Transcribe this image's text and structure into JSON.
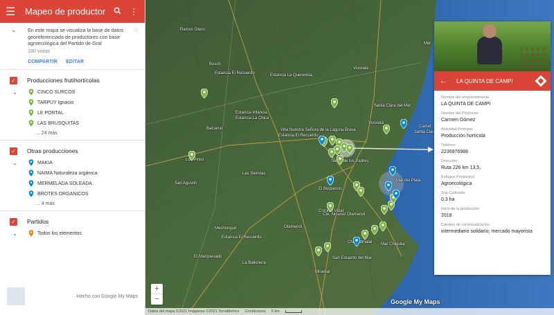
{
  "header": {
    "title": "Mapeo de productores ...",
    "menu_icon": "menu-icon",
    "search_icon": "search-icon",
    "more_icon": "more-vert-icon"
  },
  "description": {
    "text": "En este mapa se visualiza la base de datos georeferenciada de productores con base agroecológica del Partido de Gral",
    "views": "180 vistas",
    "share_label": "COMPARTIR",
    "edit_label": "EDITAR"
  },
  "layers": [
    {
      "title": "Producciones frutihortícolas",
      "pin_color": "#7cb342",
      "items": [
        "CINCO SURCOS",
        "TARPUY Ignacio",
        "LE PORTAL",
        "LAS BRUSQUITAS"
      ],
      "more": "... 24 más"
    },
    {
      "title": "Otras producciones",
      "pin_color": "#0288d1",
      "items": [
        "MAKIA",
        "NAIMA Naturaleza orgánica",
        "MERMELADA SOLEADA",
        "BROTES ORGANICOS"
      ],
      "more": "... 4 más"
    },
    {
      "title": "Partidos",
      "pin_color": "#f57c00",
      "items": [
        "Todos los elementos"
      ],
      "more": ""
    }
  ],
  "footer": {
    "made_with": "Hecho con Google My Maps"
  },
  "map": {
    "labels": [
      {
        "text": "Ramos Otero"
      },
      {
        "text": "Bosch"
      },
      {
        "text": "Estancia El Recuerdo"
      },
      {
        "text": "Estancia La Querencia"
      },
      {
        "text": "Vivorata"
      },
      {
        "text": "Mar"
      },
      {
        "text": "Estancia Infancia"
      },
      {
        "text": "Estancia La Chica"
      },
      {
        "text": "Villa Nuestra Señora de la Laguna Brava"
      },
      {
        "text": "Estancia El Recuerdo"
      },
      {
        "text": "Balcarce"
      },
      {
        "text": "Los Pinos"
      },
      {
        "text": "Las Sierritas"
      },
      {
        "text": "San Agustín"
      },
      {
        "text": "El Boqueron"
      },
      {
        "text": "Mechongué"
      },
      {
        "text": "Otamendi"
      },
      {
        "text": "Coronel Vidal"
      },
      {
        "text": "Estancia El Recuerdo"
      },
      {
        "text": "Santa Clara del Mar"
      },
      {
        "text": "Sierra de los Padres"
      },
      {
        "text": "Mar del Plata"
      },
      {
        "text": "Cte. Nicanor Otamendi"
      },
      {
        "text": "Chapadmalal"
      },
      {
        "text": "San Eduardo del Mar"
      },
      {
        "text": "Miramar"
      },
      {
        "text": "La Ballenera"
      },
      {
        "text": "El Marquesado"
      },
      {
        "text": "Vivoratá"
      },
      {
        "text": "Camet"
      },
      {
        "text": "Santa Clara del Mar"
      },
      {
        "text": "Mar Chiquita"
      }
    ],
    "zoom_in": "+",
    "zoom_out": "−",
    "brand": "Google My Maps",
    "attribution": "Datos del mapa ©2021 Imágenes ©2021 TerraMetrics",
    "conditions": "Condiciones",
    "scale": "5 km"
  },
  "panel": {
    "title": "LA QUINTA DE CAMPI",
    "fields": [
      {
        "label": "Nombre del emprendimiento",
        "value": "LA QUINTA DE CAMPI"
      },
      {
        "label": "Nombre del Productor",
        "value": "Carmen Gómez"
      },
      {
        "label": "Actividad Principal",
        "value": "Producción hortícola"
      },
      {
        "label": "Teléfono",
        "value": "2236976988"
      },
      {
        "label": "Dirección",
        "value": "Ruta 226 km 13,5,"
      },
      {
        "label": "Enfoque Productivo",
        "value": "Agroecológica"
      },
      {
        "label": "Sup Cultivada",
        "value": "0,3 ha"
      },
      {
        "label": "Inicio de la producción",
        "value": "2018"
      },
      {
        "label": "Canales de comercialización",
        "value": "intermediario solidario; mercado mayorista"
      }
    ]
  }
}
